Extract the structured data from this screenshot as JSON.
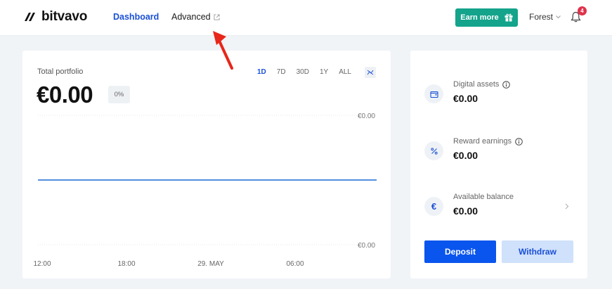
{
  "header": {
    "brand": "bitvavo",
    "nav": {
      "dashboard": "Dashboard",
      "advanced": "Advanced"
    },
    "earn_button": "Earn more",
    "user": "Forest",
    "notifications_count": "4"
  },
  "portfolio": {
    "label": "Total portfolio",
    "value": "€0.00",
    "change": "0%",
    "ranges": [
      "1D",
      "7D",
      "30D",
      "1Y",
      "ALL"
    ],
    "active_range": "1D"
  },
  "chart_data": {
    "type": "line",
    "y_tick_labels": [
      "€0.00",
      "€0.00"
    ],
    "x_tick_labels": [
      "12:00",
      "18:00",
      "29. MAY",
      "06:00"
    ],
    "series": [
      {
        "values": [
          0,
          0,
          0,
          0,
          0
        ]
      }
    ],
    "ylim": [
      -1,
      1
    ],
    "grid": "horizontal dotted",
    "line_color": "#1a6bd6"
  },
  "summary": {
    "digital_assets": {
      "label": "Digital assets",
      "value": "€0.00"
    },
    "reward_earnings": {
      "label": "Reward earnings",
      "value": "€0.00"
    },
    "available_balance": {
      "label": "Available balance",
      "value": "€0.00",
      "icon_glyph": "€"
    }
  },
  "actions": {
    "deposit": "Deposit",
    "withdraw": "Withdraw"
  },
  "colors": {
    "accent": "#1a4fd6",
    "earn": "#14a38b",
    "deposit": "#0a55ee",
    "withdraw_bg": "#cfe1fb",
    "badge": "#e0334c",
    "arrow": "#e8261a"
  },
  "icons": [
    "bitvavo-logo-icon",
    "external-link-icon",
    "gift-icon",
    "chevron-down-icon",
    "bell-icon",
    "chart-toggle-icon",
    "wallet-icon",
    "percent-icon",
    "euro-icon",
    "info-icon",
    "chevron-right-icon",
    "annotation-arrow-icon"
  ]
}
